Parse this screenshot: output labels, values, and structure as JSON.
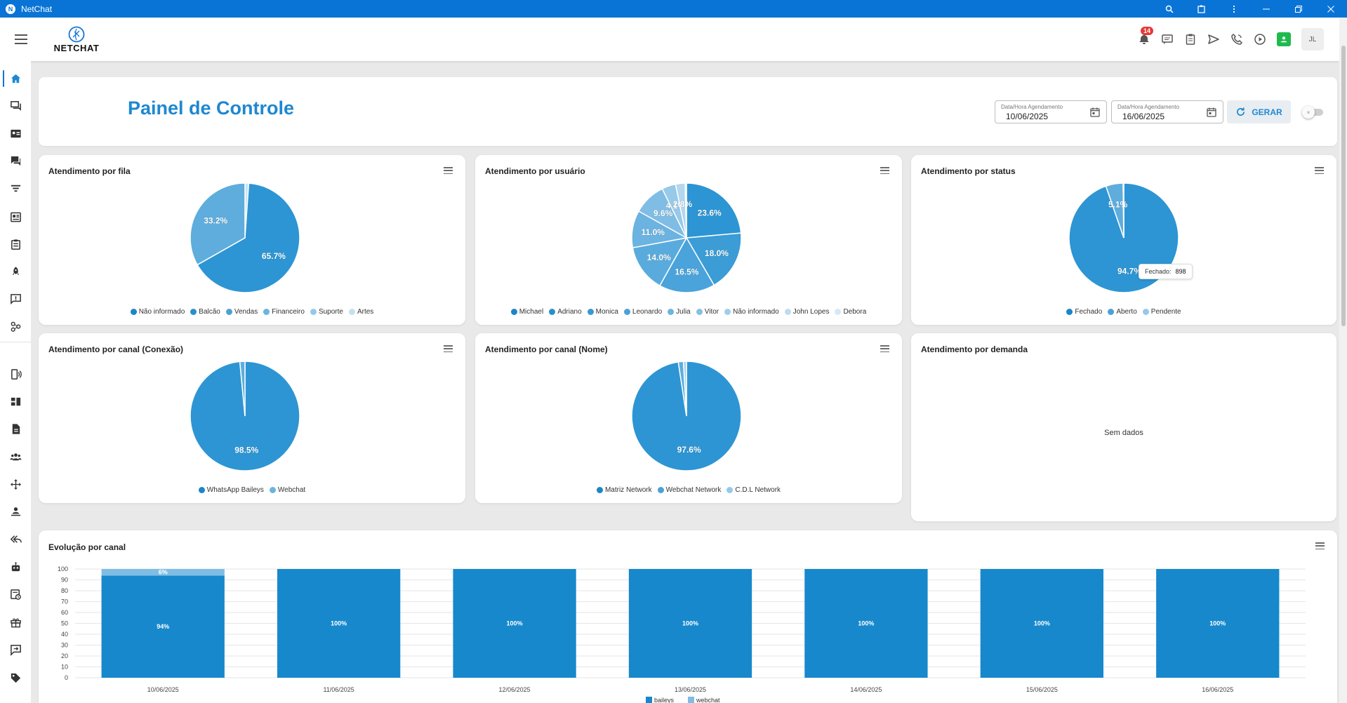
{
  "window": {
    "title": "NetChat",
    "app_icon": "netchat-logo"
  },
  "header": {
    "logo_text": "NETCHAT",
    "notifications_count": "14",
    "avatar_initials": "JL"
  },
  "sidebar": {
    "items": [
      {
        "icon": "home-icon"
      },
      {
        "icon": "chat-bubbles-icon"
      },
      {
        "icon": "contact-card-icon"
      },
      {
        "icon": "forum-icon"
      },
      {
        "icon": "filter-icon"
      },
      {
        "icon": "news-icon"
      },
      {
        "icon": "clipboard-icon"
      },
      {
        "icon": "rocket-icon"
      },
      {
        "icon": "announcement-icon"
      },
      {
        "icon": "hub-icon"
      },
      {
        "icon": "phone-wireless-icon"
      },
      {
        "icon": "dashboard-icon"
      },
      {
        "icon": "file-icon"
      },
      {
        "icon": "group-icon"
      },
      {
        "icon": "move-icon"
      },
      {
        "icon": "person-pin-icon"
      },
      {
        "icon": "reply-all-icon"
      },
      {
        "icon": "robot-icon"
      },
      {
        "icon": "campaign-icon"
      },
      {
        "icon": "gift-icon"
      },
      {
        "icon": "transfer-icon"
      },
      {
        "icon": "tag-icon"
      }
    ]
  },
  "dashboard": {
    "title": "Painel de Controle",
    "date_label": "Data/Hora Agendamento",
    "date_start": "10/06/2025",
    "date_end": "16/06/2025",
    "gerar_label": "GERAR",
    "toggle_knob": "×"
  },
  "colors": {
    "primary": "#1e88d0",
    "pie_main": "#2d95d3"
  },
  "pies": [
    {
      "title": "Atendimento por fila",
      "slices": [
        {
          "label": "Não informado",
          "value": 1.1,
          "color": "#c9e3f4"
        },
        {
          "label": "Balcão",
          "value": 65.7,
          "color": "#2d95d3",
          "text": "65.7%"
        },
        {
          "label": "Vendas",
          "value": 33.2,
          "color": "#5eaddd",
          "text": "33.2%"
        }
      ],
      "legend": [
        {
          "label": "Não informado",
          "color": "#1a86c8"
        },
        {
          "label": "Balcão",
          "color": "#2990cc"
        },
        {
          "label": "Vendas",
          "color": "#4aa1d6"
        },
        {
          "label": "Financeiro",
          "color": "#6db4df"
        },
        {
          "label": "Suporte",
          "color": "#95c9e9"
        },
        {
          "label": "Artes",
          "color": "#c3e0f2"
        }
      ]
    },
    {
      "title": "Atendimento por usuário",
      "slices": [
        {
          "label": "Michael",
          "value": 23.6,
          "color": "#2d95d3",
          "text": "23.6%"
        },
        {
          "label": "Adriano",
          "value": 18.0,
          "color": "#3b9cd6",
          "text": "18.0%"
        },
        {
          "label": "Monica",
          "value": 16.5,
          "color": "#4aa3da",
          "text": "16.5%"
        },
        {
          "label": "Leonardo",
          "value": 14.0,
          "color": "#5aabdd",
          "text": "14.0%"
        },
        {
          "label": "Julia",
          "value": 11.0,
          "color": "#6bb3e0",
          "text": "11.0%"
        },
        {
          "label": "Vitor",
          "value": 9.6,
          "color": "#7fbde4",
          "text": "9.6%"
        },
        {
          "label": "Não informado",
          "value": 4.1,
          "color": "#97c9e9",
          "text": "4.1%"
        },
        {
          "label": "John Lopes",
          "value": 2.8,
          "color": "#b2d7ef",
          "text": "2.8%"
        },
        {
          "label": "Debora",
          "value": 0.4,
          "color": "#cde5f5"
        }
      ],
      "legend": [
        {
          "label": "Michael",
          "color": "#1a86c8"
        },
        {
          "label": "Adriano",
          "color": "#2990cc"
        },
        {
          "label": "Monica",
          "color": "#3a98d2"
        },
        {
          "label": "Leonardo",
          "color": "#4aa1d6"
        },
        {
          "label": "Julia",
          "color": "#6db4df"
        },
        {
          "label": "Vitor",
          "color": "#84bfe4"
        },
        {
          "label": "Não informado",
          "color": "#9fcdeb"
        },
        {
          "label": "John Lopes",
          "color": "#bcdcf1"
        },
        {
          "label": "Debora",
          "color": "#d5e9f7"
        }
      ]
    },
    {
      "title": "Atendimento por status",
      "slices": [
        {
          "label": "Fechado",
          "value": 94.7,
          "color": "#2d95d3",
          "text": "94.7%"
        },
        {
          "label": "Aberto",
          "value": 5.1,
          "color": "#5eaddd",
          "text": "5.1%"
        },
        {
          "label": "Pendente",
          "value": 0.2,
          "color": "#a8d1ec"
        }
      ],
      "legend": [
        {
          "label": "Fechado",
          "color": "#1a86c8"
        },
        {
          "label": "Aberto",
          "color": "#4aa1d6"
        },
        {
          "label": "Pendente",
          "color": "#95c9e9"
        }
      ],
      "tooltip": {
        "label": "Fechado:",
        "value": "898"
      }
    },
    {
      "title": "Atendimento por canal (Conexão)",
      "slices": [
        {
          "label": "WhatsApp Baileys",
          "value": 98.5,
          "color": "#2d95d3",
          "text": "98.5%"
        },
        {
          "label": "Webchat",
          "value": 1.5,
          "color": "#5eaddd"
        }
      ],
      "legend": [
        {
          "label": "WhatsApp Baileys",
          "color": "#1a86c8"
        },
        {
          "label": "Webchat",
          "color": "#6db4df"
        }
      ]
    },
    {
      "title": "Atendimento por canal (Nome)",
      "slices": [
        {
          "label": "Matriz Network",
          "value": 97.6,
          "color": "#2d95d3",
          "text": "97.6%"
        },
        {
          "label": "Webchat Network",
          "value": 1.5,
          "color": "#5eaddd"
        },
        {
          "label": "C.D.L Network",
          "value": 0.9,
          "color": "#a8d1ec"
        }
      ],
      "legend": [
        {
          "label": "Matriz Network",
          "color": "#1a86c8"
        },
        {
          "label": "Webchat Network",
          "color": "#4aa1d6"
        },
        {
          "label": "C.D.L Network",
          "color": "#95c9e9"
        }
      ]
    }
  ],
  "demanda": {
    "title": "Atendimento por demanda",
    "empty_text": "Sem dados"
  },
  "chart_data": {
    "type": "bar",
    "title": "Evolução por canal",
    "stacked": true,
    "categories": [
      "10/06/2025",
      "11/06/2025",
      "12/06/2025",
      "13/06/2025",
      "14/06/2025",
      "15/06/2025",
      "16/06/2025"
    ],
    "series": [
      {
        "name": "baileys",
        "values": [
          94,
          100,
          100,
          100,
          100,
          100,
          100
        ],
        "labels": [
          "94%",
          "100%",
          "100%",
          "100%",
          "100%",
          "100%",
          "100%"
        ],
        "color": "#1788cc"
      },
      {
        "name": "webchat",
        "values": [
          6,
          0,
          0,
          0,
          0,
          0,
          0
        ],
        "labels": [
          "6%",
          "",
          "",
          "",
          "",
          "",
          ""
        ],
        "color": "#7fbde4"
      }
    ],
    "ylim": [
      0,
      100
    ],
    "yticks": [
      "100",
      "90",
      "80",
      "70",
      "60",
      "50",
      "40",
      "30",
      "20",
      "10",
      "0"
    ],
    "grid": true,
    "legend_position": "bottom"
  }
}
